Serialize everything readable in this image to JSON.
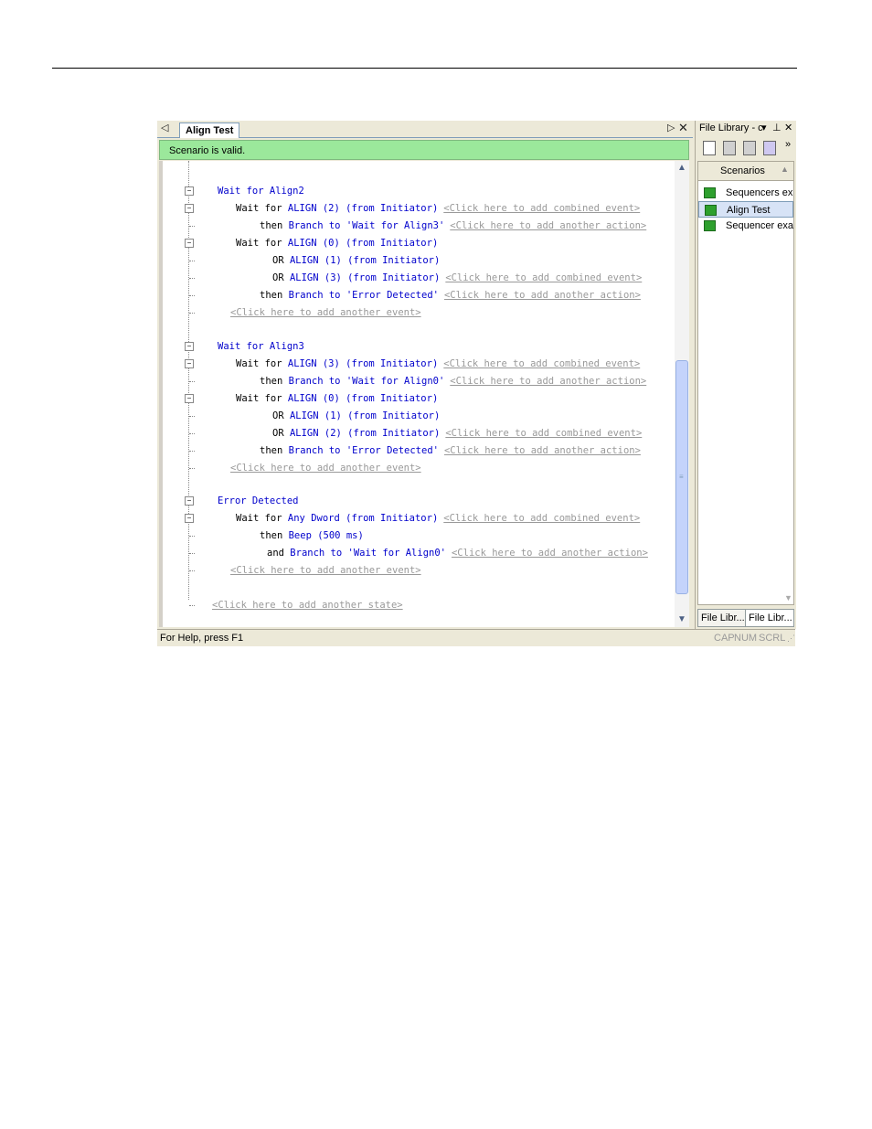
{
  "editor": {
    "tab_label": "Align Test",
    "status_message": "Scenario is valid."
  },
  "lines": [
    {
      "id": "s1",
      "parts": [
        {
          "t": "Wait for Align2",
          "c": "blue"
        }
      ]
    },
    {
      "id": "s1e1",
      "parts": [
        {
          "t": "Wait for ",
          "c": "kw"
        },
        {
          "t": "ALIGN (2) (from Initiator)",
          "c": "blue"
        }
      ],
      "link": "<Click here to add combined event>"
    },
    {
      "id": "s1a1",
      "parts": [
        {
          "t": "then ",
          "c": "kw"
        },
        {
          "t": "Branch to 'Wait for Align3'",
          "c": "blue"
        }
      ],
      "link": "<Click here to add another action>"
    },
    {
      "id": "s1e2",
      "parts": [
        {
          "t": "Wait for ",
          "c": "kw"
        },
        {
          "t": "ALIGN (0) (from Initiator)",
          "c": "blue"
        }
      ]
    },
    {
      "id": "s1e2b",
      "parts": [
        {
          "t": "OR ",
          "c": "kw"
        },
        {
          "t": "ALIGN (1) (from Initiator)",
          "c": "blue"
        }
      ]
    },
    {
      "id": "s1e2c",
      "parts": [
        {
          "t": "OR ",
          "c": "kw"
        },
        {
          "t": "ALIGN (3) (from Initiator)",
          "c": "blue"
        }
      ],
      "link": "<Click here to add combined event>"
    },
    {
      "id": "s1a2",
      "parts": [
        {
          "t": "then ",
          "c": "kw"
        },
        {
          "t": "Branch to 'Error Detected'",
          "c": "blue"
        }
      ],
      "link": "<Click here to add another action>"
    },
    {
      "id": "s1add",
      "parts": [],
      "link": "<Click here to add another event>"
    },
    {
      "id": "s2",
      "parts": [
        {
          "t": "Wait for Align3",
          "c": "blue"
        }
      ]
    },
    {
      "id": "s2e1",
      "parts": [
        {
          "t": "Wait for ",
          "c": "kw"
        },
        {
          "t": "ALIGN (3) (from Initiator)",
          "c": "blue"
        }
      ],
      "link": "<Click here to add combined event>"
    },
    {
      "id": "s2a1",
      "parts": [
        {
          "t": "then ",
          "c": "kw"
        },
        {
          "t": "Branch to 'Wait for Align0'",
          "c": "blue"
        }
      ],
      "link": "<Click here to add another action>"
    },
    {
      "id": "s2e2",
      "parts": [
        {
          "t": "Wait for ",
          "c": "kw"
        },
        {
          "t": "ALIGN (0) (from Initiator)",
          "c": "blue"
        }
      ]
    },
    {
      "id": "s2e2b",
      "parts": [
        {
          "t": "OR ",
          "c": "kw"
        },
        {
          "t": "ALIGN (1) (from Initiator)",
          "c": "blue"
        }
      ]
    },
    {
      "id": "s2e2c",
      "parts": [
        {
          "t": "OR ",
          "c": "kw"
        },
        {
          "t": "ALIGN (2) (from Initiator)",
          "c": "blue"
        }
      ],
      "link": "<Click here to add combined event>"
    },
    {
      "id": "s2a2",
      "parts": [
        {
          "t": "then ",
          "c": "kw"
        },
        {
          "t": "Branch to 'Error Detected'",
          "c": "blue"
        }
      ],
      "link": "<Click here to add another action>"
    },
    {
      "id": "s2add",
      "parts": [],
      "link": "<Click here to add another event>"
    },
    {
      "id": "s3",
      "parts": [
        {
          "t": "Error Detected",
          "c": "blue"
        }
      ]
    },
    {
      "id": "s3e1",
      "parts": [
        {
          "t": "Wait for ",
          "c": "kw"
        },
        {
          "t": "Any Dword (from Initiator)",
          "c": "blue"
        }
      ],
      "link": "<Click here to add combined event>"
    },
    {
      "id": "s3a1",
      "parts": [
        {
          "t": "then ",
          "c": "kw"
        },
        {
          "t": "Beep (500 ms)",
          "c": "blue"
        }
      ]
    },
    {
      "id": "s3a2",
      "parts": [
        {
          "t": "and ",
          "c": "kw"
        },
        {
          "t": "Branch to 'Wait for Align0'",
          "c": "blue"
        }
      ],
      "link": "<Click here to add another action>"
    },
    {
      "id": "s3add",
      "parts": [],
      "link": "<Click here to add another event>"
    },
    {
      "id": "addstate",
      "parts": [],
      "link": "<Click here to add another state>"
    }
  ],
  "statusbar": {
    "help": "For Help, press F1",
    "cap": "CAP",
    "num": "NUM",
    "scrl": "SCRL"
  },
  "panel": {
    "title": "File Library - c",
    "list_header": "Scenarios",
    "items": [
      "Sequencers ex...",
      "Align Test",
      "Sequencer exa..."
    ],
    "selected_index": 1,
    "tabs": [
      "File Libr...",
      "File Libr..."
    ]
  },
  "colors": {
    "status_green": "#9be89b",
    "keyword_blue": "#0000cc",
    "link_gray": "#999999"
  }
}
